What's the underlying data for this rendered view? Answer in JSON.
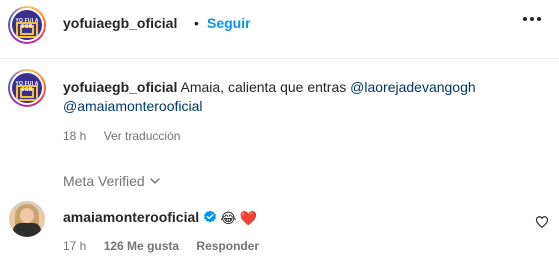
{
  "post_header": {
    "username": "yofuiaegb_oficial",
    "separator": "•",
    "follow_label": "Seguir",
    "avatar_logo_text": "YO FUI A EGB"
  },
  "caption": {
    "username": "yofuiaegb_oficial",
    "text": "Amaia, calienta que entras",
    "mention_1": "@laorejadevangogh",
    "mention_2": "@amaiamonterooficial",
    "time": "18 h",
    "translate_label": "Ver traducción"
  },
  "meta_verified": {
    "label": "Meta Verified",
    "icon": "chevron-down-icon"
  },
  "reply": {
    "username": "amaiamonterooficial",
    "verified_icon": "verified-badge-icon",
    "emoji_1": "😂",
    "emoji_2": "❤️",
    "time": "17 h",
    "likes": "126 Me gusta",
    "reply_label": "Responder",
    "like_icon": "heart-outline-icon"
  },
  "colors": {
    "link_blue": "#0095f6",
    "mention_blue": "#00376b",
    "verified_blue": "#0095f6",
    "muted": "#737373"
  }
}
